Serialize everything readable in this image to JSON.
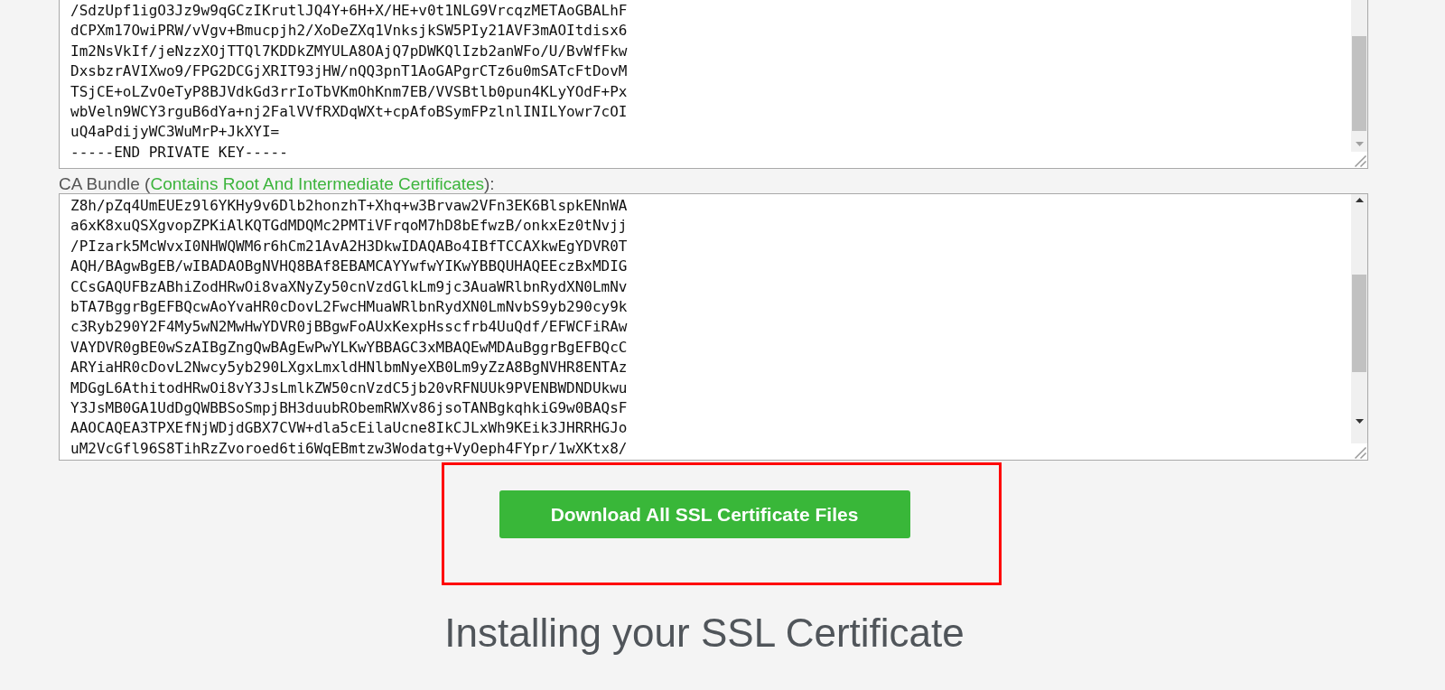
{
  "private_key_field": {
    "lines": [
      "/SdzUpf1igO3Jz9w9qGCzIKrutlJQ4Y+6H+X/HE+v0t1NLG9VrcqzMETAoGBALhF",
      "dCPXm17OwiPRW/vVgv+Bmucpjh2/XoDeZXq1VnksjkSW5PIy21AVF3mAOItdisx6",
      "Im2NsVkIf/jeNzzXOjTTQl7KDDkZMYULA8OAjQ7pDWKQlIzb2anWFo/U/BvWfFkw",
      "DxsbzrAVIXwo9/FPG2DCGjXRIT93jHW/nQQ3pnT1AoGAPgrCTz6u0mSATcFtDovM",
      "TSjCE+oLZvOeTyP8BJVdkGd3rrIoTbVKmOhKnm7EB/VVSBtlb0pun4KLyYOdF+Px",
      "wbVeln9WCY3rguB6dYa+nj2FalVVfRXDqWXt+cpAfoBSymFPzlnlINILYowr7cOI",
      "uQ4aPdijyWC3WuMrP+JkXYI=",
      "-----END PRIVATE KEY-----"
    ]
  },
  "ca_bundle": {
    "label_prefix": "CA Bundle (",
    "label_link": "Contains Root And Intermediate Certificates",
    "label_suffix": "):",
    "lines": [
      "Z8h/pZq4UmEUEz9l6YKHy9v6Dlb2honzhT+Xhq+w3Brvaw2VFn3EK6BlspkENnWA",
      "a6xK8xuQSXgvopZPKiAlKQTGdMDQMc2PMTiVFrqoM7hD8bEfwzB/onkxEz0tNvjj",
      "/PIzark5McWvxI0NHWQWM6r6hCm21AvA2H3DkwIDAQABo4IBfTCCAXkwEgYDVR0T",
      "AQH/BAgwBgEB/wIBADAOBgNVHQ8BAf8EBAMCAYYwfwYIKwYBBQUHAQEEczBxMDIG",
      "CCsGAQUFBzABhiZodHRwOi8vaXNyZy50cnVzdGlkLm9jc3AuaWRlbnRydXN0LmNv",
      "bTA7BggrBgEFBQcwAoYvaHR0cDovL2FwcHMuaWRlbnRydXN0LmNvbS9yb290cy9k",
      "c3Ryb290Y2F4My5wN2MwHwYDVR0jBBgwFoAUxKexpHsscfrb4UuQdf/EFWCFiRAw",
      "VAYDVR0gBE0wSzAIBgZngQwBAgEwPwYLKwYBBAGC3xMBAQEwMDAuBggrBgEFBQcC",
      "ARYiaHR0cDovL2Nwcy5yb290LXgxLmxldHNlbmNyeXB0Lm9yZzA8BgNVHR8ENTAz",
      "MDGgL6AthitodHRwOi8vY3JsLmlkZW50cnVzdC5jb20vRFNUUk9PVENBWDNDUkwu",
      "Y3JsMB0GA1UdDgQWBBSoSmpjBH3duubRObemRWXv86jsoTANBgkqhkiG9w0BAQsF",
      "AAOCAQEA3TPXEfNjWDjdGBX7CVW+dla5cEilaUcne8IkCJLxWh9KEik3JHRRHGJo",
      "uM2VcGfl96S8TihRzZvoroed6ti6WqEBmtzw3Wodatg+VyOeph4FYpr/1wXKtx8/"
    ]
  },
  "download_button": {
    "label": "Download All SSL Certificate Files"
  },
  "highlight": {
    "shown": true
  },
  "section_heading": "Installing your SSL Certificate"
}
